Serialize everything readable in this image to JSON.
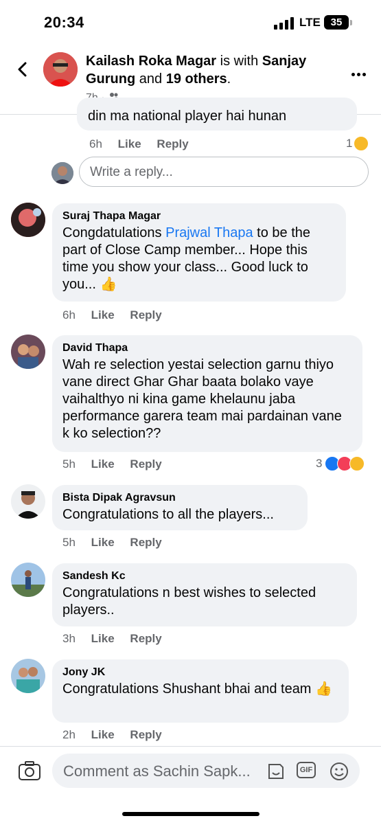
{
  "status_bar": {
    "time": "20:34",
    "network": "LTE",
    "battery": "35"
  },
  "header": {
    "author": "Kailash Roka Magar",
    "with_text": "is with",
    "tagged": "Sanjay Gurung",
    "and_text": "and",
    "others": "19 others",
    "period": ".",
    "time": "7h",
    "separator": "·"
  },
  "cut_comment": {
    "text": "din ma national player hai hunan"
  },
  "cut_actions": {
    "time": "6h",
    "like": "Like",
    "reply": "Reply",
    "reaction_count": "1"
  },
  "reply_box": {
    "placeholder": "Write a reply..."
  },
  "comments": [
    {
      "name": "Suraj Thapa Magar",
      "pre": "Congdatulations ",
      "mention": "Prajwal Thapa",
      "post": " to be the part of Close Camp member... Hope this time you show your class... Good luck to you... 👍",
      "time": "6h",
      "like": "Like",
      "reply": "Reply"
    },
    {
      "name": "David Thapa",
      "text": "Wah re selection yestai selection garnu thiyo vane direct Ghar Ghar baata bolako vaye vaihalthyo ni kina game khelaunu jaba performance garera team mai pardainan vane k ko selection??",
      "time": "5h",
      "like": "Like",
      "reply": "Reply",
      "reaction_count": "3"
    },
    {
      "name": "Bista Dipak Agravsun",
      "text": "Congratulations to all the players...",
      "time": "5h",
      "like": "Like",
      "reply": "Reply"
    },
    {
      "name": "Sandesh Kc",
      "text": "Congratulations n best wishes to selected players..",
      "time": "3h",
      "like": "Like",
      "reply": "Reply"
    },
    {
      "name": "Jony JK",
      "text": "Congratulations Shushant bhai and team 👍",
      "time": "2h",
      "like": "Like",
      "reply": "Reply"
    }
  ],
  "composer": {
    "placeholder": "Comment as Sachin Sapk...",
    "gif_label": "GIF"
  },
  "colors": {
    "accent": "#1877f2",
    "bubble": "#f0f2f5",
    "meta": "#65676b"
  }
}
